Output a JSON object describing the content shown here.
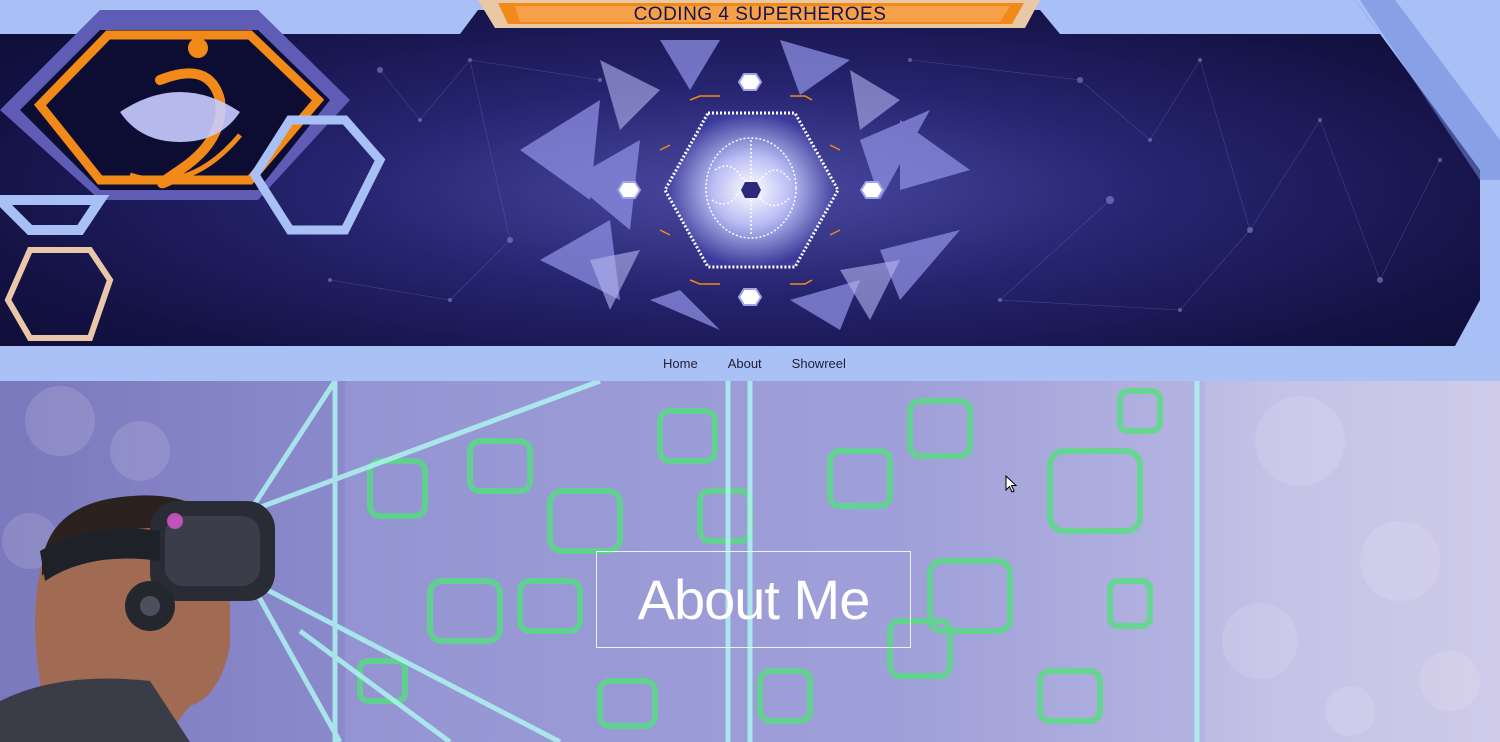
{
  "header": {
    "title": "CODING 4 SUPERHEROES",
    "logo_icon": "superhero-s-logo-icon",
    "center_graphic": "brain-hexagon-icon"
  },
  "nav": {
    "items": [
      {
        "label": "Home"
      },
      {
        "label": "About"
      },
      {
        "label": "Showreel"
      }
    ]
  },
  "hero": {
    "heading": "About Me",
    "image": "vr-headset-person-image"
  },
  "colors": {
    "nav_bg": "#a9c1f4",
    "header_bg": "#1a1855",
    "accent_orange": "#f28a1a",
    "frame_blue": "#a8c0f5"
  }
}
